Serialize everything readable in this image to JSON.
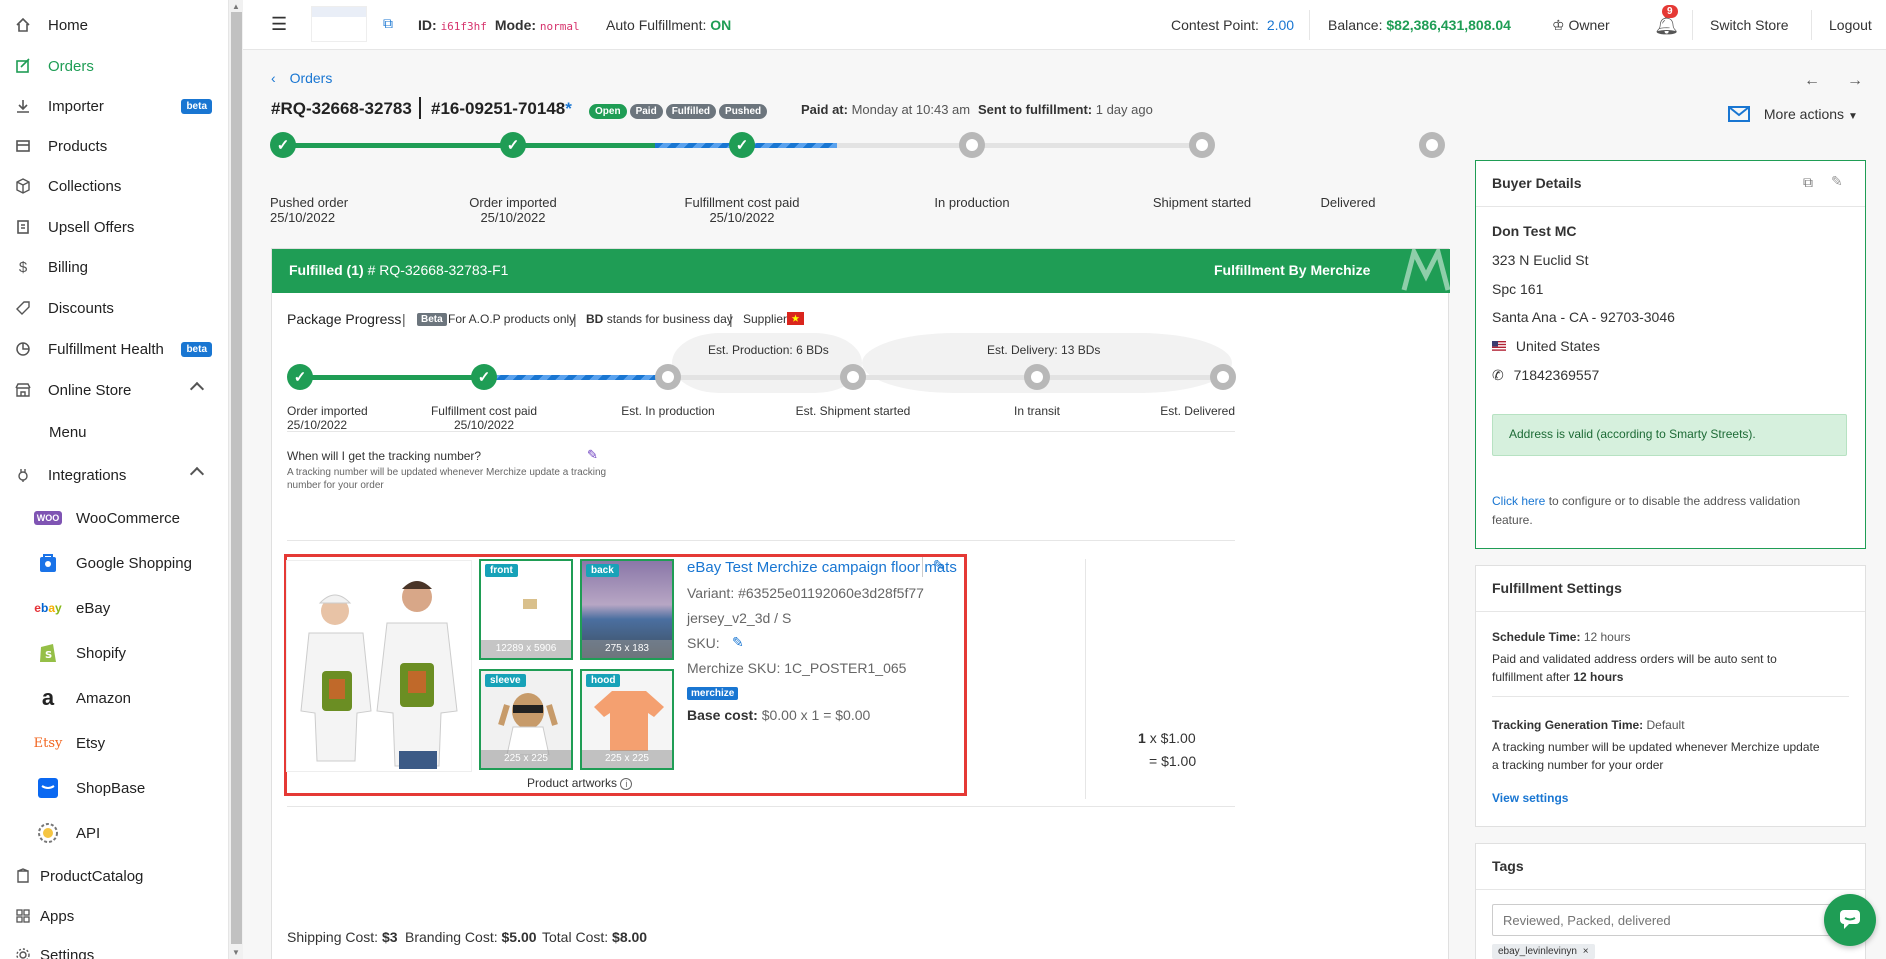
{
  "sidebar": {
    "items": [
      {
        "label": "Home",
        "icon": "home-icon"
      },
      {
        "label": "Orders",
        "icon": "orders-icon"
      },
      {
        "label": "Importer",
        "icon": "download-icon",
        "badge": "beta"
      },
      {
        "label": "Products",
        "icon": "products-icon"
      },
      {
        "label": "Collections",
        "icon": "box-icon"
      },
      {
        "label": "Upsell Offers",
        "icon": "upsell-icon"
      },
      {
        "label": "Billing",
        "icon": "dollar-icon"
      },
      {
        "label": "Discounts",
        "icon": "tag-icon"
      },
      {
        "label": "Fulfillment Health",
        "icon": "pie-chart-icon",
        "badge": "beta"
      },
      {
        "label": "Online Store",
        "icon": "store-icon"
      },
      {
        "label": "Menu"
      },
      {
        "label": "Integrations",
        "icon": "plug-icon"
      },
      {
        "label": "WooCommerce",
        "icon": "woocommerce-logo-icon"
      },
      {
        "label": "Google Shopping",
        "icon": "google-shopping-logo-icon"
      },
      {
        "label": "eBay",
        "icon": "ebay-logo-icon"
      },
      {
        "label": "Shopify",
        "icon": "shopify-logo-icon"
      },
      {
        "label": "Amazon",
        "icon": "amazon-logo-icon"
      },
      {
        "label": "Etsy",
        "icon": "etsy-logo-icon"
      },
      {
        "label": "ShopBase",
        "icon": "shopbase-logo-icon"
      },
      {
        "label": "API",
        "icon": "api-logo-icon"
      },
      {
        "label": "ProductCatalog",
        "icon": "catalog-icon"
      },
      {
        "label": "Apps",
        "icon": "apps-grid-icon"
      },
      {
        "label": "Settings",
        "icon": "gear-icon"
      }
    ]
  },
  "topbar": {
    "id_label": "ID:",
    "id_value": "i61f3hf",
    "mode_label": "Mode:",
    "mode_value": "normal",
    "auto_label": "Auto Fulfillment:",
    "auto_value": "ON",
    "contest_label": "Contest Point:",
    "contest_value": "2.00",
    "balance_label": "Balance:",
    "balance_value": "$82,386,431,808.04",
    "owner": "Owner",
    "notifications": "9",
    "switch_store": "Switch Store",
    "logout": "Logout"
  },
  "order": {
    "breadcrumb": "Orders",
    "number": "#RQ-32668-32783",
    "external_number": "#16-09251-70148",
    "external_star": "*",
    "badges": [
      "Open",
      "Paid",
      "Fulfilled",
      "Pushed"
    ],
    "paid_at_label": "Paid at:",
    "paid_at_value": "Monday at 10:43 am",
    "sent_label": "Sent to fulfillment:",
    "sent_value": "1 day ago",
    "more_actions": "More actions"
  },
  "main_progress": [
    {
      "label": "Pushed order",
      "date": "25/10/2022",
      "status": "done"
    },
    {
      "label": "Order imported",
      "date": "25/10/2022",
      "status": "done"
    },
    {
      "label": "Fulfillment cost paid",
      "date": "25/10/2022",
      "status": "done"
    },
    {
      "label": "In production",
      "date": "",
      "status": "todo"
    },
    {
      "label": "Shipment started",
      "date": "",
      "status": "todo"
    },
    {
      "label": "Delivered",
      "date": "",
      "status": "todo"
    }
  ],
  "fulfillment": {
    "title": "Fulfilled (1)",
    "code": "# RQ-32668-32783-F1",
    "by": "Fulfillment By Merchize",
    "package_progress": "Package Progress",
    "beta": "Beta",
    "aop_note": "For A.O.P products only",
    "bd": "BD",
    "bd_note": "stands for business day",
    "supplier": "Supplier:",
    "est_production": "Est. Production:",
    "est_production_value": "6 BDs",
    "est_delivery": "Est. Delivery:",
    "est_delivery_value": "13 BDs",
    "steps": [
      {
        "label": "Order imported",
        "date": "25/10/2022",
        "status": "done"
      },
      {
        "label": "Fulfillment cost paid",
        "date": "25/10/2022",
        "status": "done"
      },
      {
        "label": "Est. In production",
        "date": "",
        "status": "todo"
      },
      {
        "label": "Est. Shipment started",
        "date": "",
        "status": "todo"
      },
      {
        "label": "In transit",
        "date": "",
        "status": "todo"
      },
      {
        "label": "Est. Delivered",
        "date": "",
        "status": "todo"
      }
    ],
    "tracking_q": "When will I get the tracking number?",
    "tracking_a1": "A tracking number will be updated whenever Merchize update a tracking",
    "tracking_a2": "number for your order"
  },
  "item": {
    "title": "eBay Test Merchize campaign floor mats",
    "variant": "Variant: #63525e01192060e3d28f5f77",
    "variant_name": "jersey_v2_3d / S",
    "sku_label": "SKU:",
    "merchize_sku": "Merchize SKU: 1C_POSTER1_065",
    "merchize_badge": "merchize",
    "base_cost_label": "Base cost:",
    "base_cost_value": "$0.00 x 1 = $0.00",
    "qty": "1",
    "price": "x $1.00",
    "total": "= $1.00",
    "artworks_label": "Product artworks",
    "artworks": [
      {
        "side": "front",
        "size": "12289 x 5906"
      },
      {
        "side": "back",
        "size": "275 x 183"
      },
      {
        "side": "sleeve",
        "size": "225 x 225"
      },
      {
        "side": "hood",
        "size": "225 x 225"
      }
    ]
  },
  "costs": {
    "shipping_label": "Shipping Cost:",
    "shipping_value": "$3",
    "branding_label": "Branding Cost:",
    "branding_value": "$5.00",
    "total_label": "Total Cost:",
    "total_value": "$8.00"
  },
  "buyer": {
    "title": "Buyer Details",
    "name": "Don Test MC",
    "address1": "323 N Euclid St",
    "address2": "Spc 161",
    "city": "Santa Ana - CA - 92703-3046",
    "country": "United States",
    "phone": "71842369557",
    "valid_msg": "Address is valid (according to Smarty Streets).",
    "click_here": "Click here",
    "config_text1": "to configure or to disable the address validation",
    "config_text2": "feature."
  },
  "settings": {
    "title": "Fulfillment Settings",
    "schedule_label": "Schedule Time:",
    "schedule_value": "12 hours",
    "schedule_desc1": "Paid and validated address orders will be auto sent to",
    "schedule_desc2": "fulfillment after",
    "schedule_desc_bold": "12 hours",
    "tracking_label": "Tracking Generation Time:",
    "tracking_value": "Default",
    "tracking_desc1": "A tracking number will be updated whenever Merchize update",
    "tracking_desc2": "a tracking number for your order",
    "view": "View settings"
  },
  "tags": {
    "title": "Tags",
    "placeholder": "Reviewed, Packed, delivered",
    "chip": "ebay_levinlevinyn"
  },
  "colors": {
    "green": "#1f9d55",
    "blue": "#1976d2",
    "red_frame": "#e53935"
  }
}
